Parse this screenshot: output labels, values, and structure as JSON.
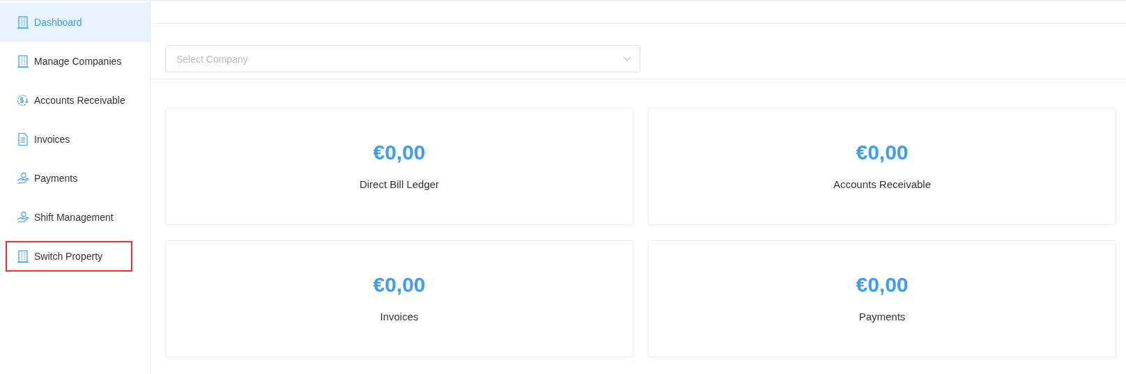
{
  "sidebar": {
    "items": [
      {
        "label": "Dashboard",
        "kind": "building",
        "selected": true,
        "highlighted": false
      },
      {
        "label": "Manage Companies",
        "kind": "building",
        "selected": false,
        "highlighted": false
      },
      {
        "label": "Accounts Receivable",
        "kind": "dollar",
        "selected": false,
        "highlighted": false
      },
      {
        "label": "Invoices",
        "kind": "document",
        "selected": false,
        "highlighted": false
      },
      {
        "label": "Payments",
        "kind": "hand",
        "selected": false,
        "highlighted": false
      },
      {
        "label": "Shift Management",
        "kind": "hand",
        "selected": false,
        "highlighted": false
      },
      {
        "label": "Switch Property",
        "kind": "building",
        "selected": false,
        "highlighted": true
      }
    ]
  },
  "company_select": {
    "placeholder": "Select Company"
  },
  "cards": [
    {
      "amount": "€0,00",
      "label": "Direct Bill Ledger"
    },
    {
      "amount": "€0,00",
      "label": "Accounts Receivable"
    },
    {
      "amount": "€0,00",
      "label": "Invoices"
    },
    {
      "amount": "€0,00",
      "label": "Payments"
    }
  ]
}
